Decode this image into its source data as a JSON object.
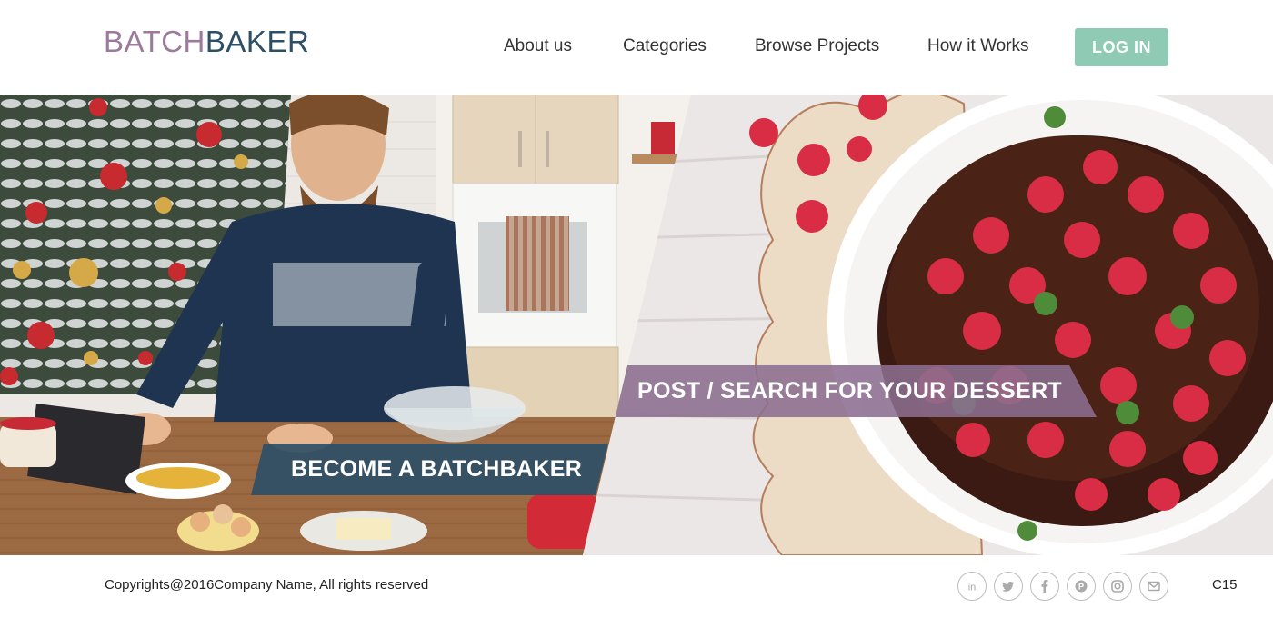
{
  "header": {
    "logo_part1": "BATCH",
    "logo_part2": "BAKER",
    "nav": [
      "About us",
      "Categories",
      "Browse Projects",
      "How it Works"
    ],
    "login_label": "LOG IN"
  },
  "hero": {
    "left_cta": "BECOME A BATCHBAKER",
    "right_cta": "POST / SEARCH FOR YOUR DESSERT"
  },
  "footer": {
    "copyright": "Copyrights@2016Company Name, All rights reserved",
    "socials": [
      "linkedin-icon",
      "twitter-icon",
      "facebook-icon",
      "pinterest-icon",
      "instagram-icon",
      "mail-icon"
    ],
    "code": "C15"
  },
  "colors": {
    "logo_light": "#9b7a9c",
    "logo_dark": "#2e4f66",
    "login_button": "#8fcab5",
    "left_cta_bg": "#2e4f66",
    "right_cta_bg": "#8c6e91"
  }
}
